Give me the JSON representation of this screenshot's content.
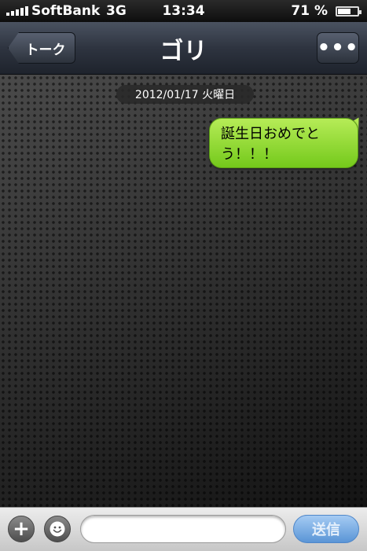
{
  "status_bar": {
    "carrier": "SoftBank",
    "network": "3G",
    "time": "13:34",
    "battery_percent_label": "71 %",
    "battery_level": 0.71
  },
  "nav_bar": {
    "back_label": "トーク",
    "title": "ゴリ",
    "menu_label": "•••"
  },
  "chat": {
    "date_label": "2012/01/17 火曜日",
    "messages": [
      {
        "text": "誕生日おめでとう！！！",
        "sender": "self",
        "color": "#8fd83a"
      }
    ]
  },
  "input_bar": {
    "plus_label": "+",
    "message_value": "",
    "message_placeholder": "",
    "send_label": "送信",
    "send_color": "#6ea4df"
  },
  "icons": {
    "plus": "plus-icon",
    "emoji": "smiley-icon",
    "menu": "more-icon",
    "back": "back-arrow-icon",
    "signal": "signal-icon",
    "battery": "battery-icon"
  }
}
